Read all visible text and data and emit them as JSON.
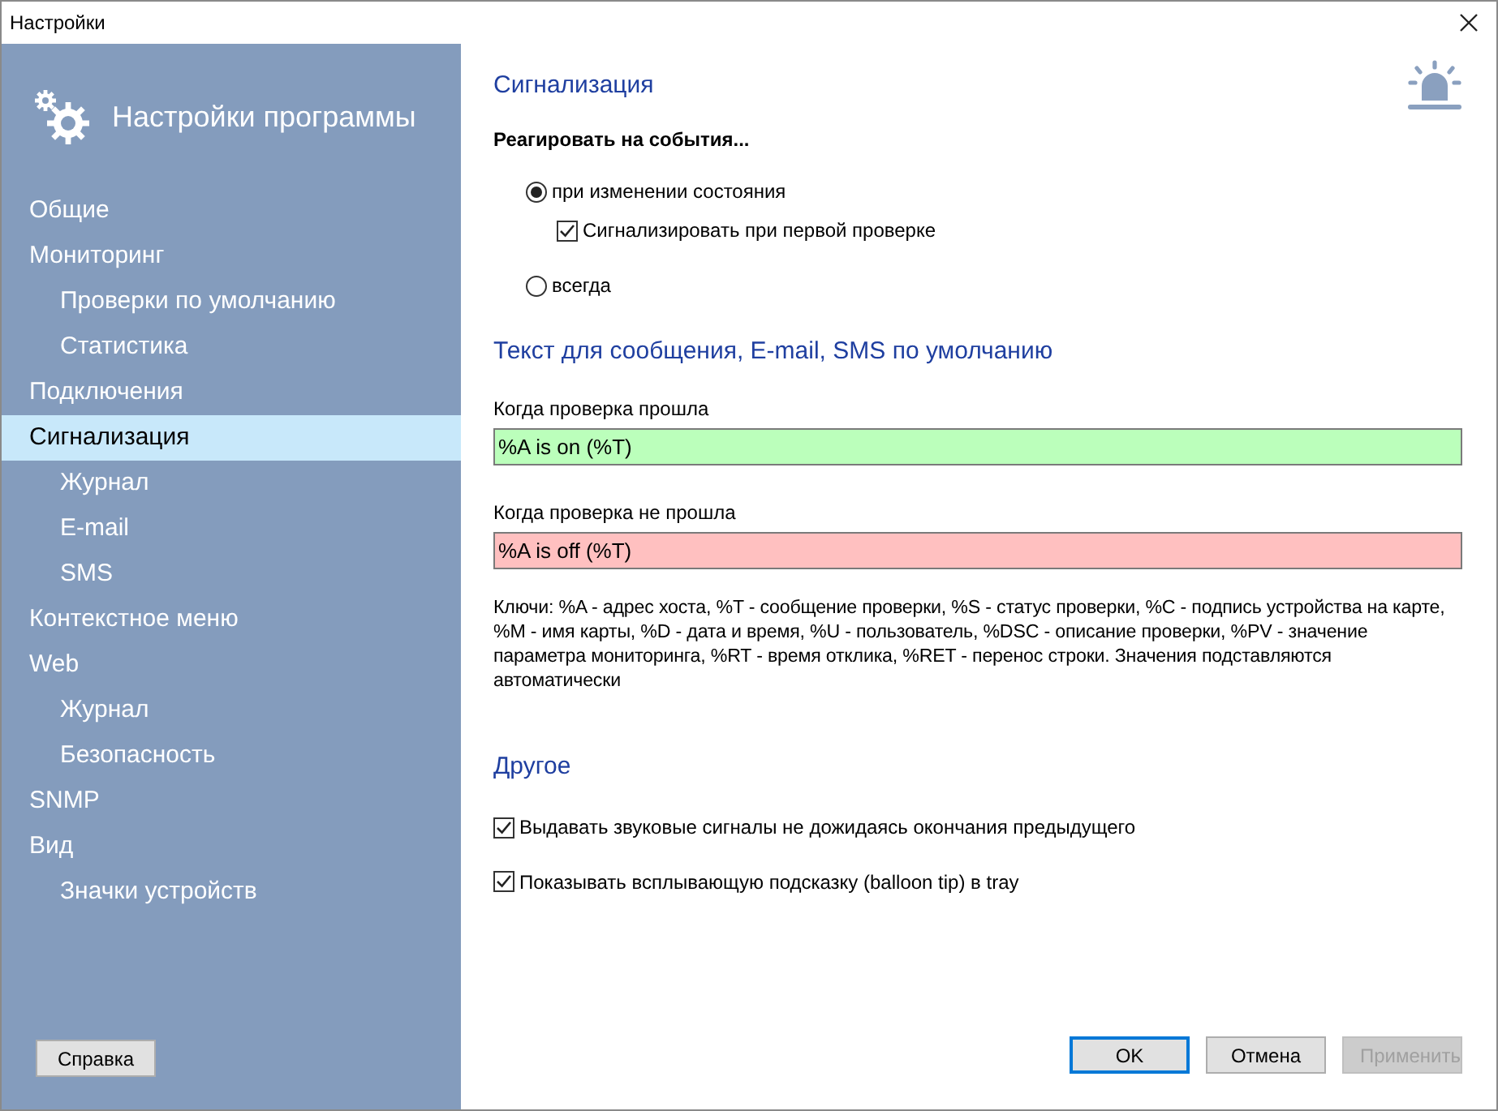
{
  "window": {
    "title": "Настройки"
  },
  "sidebar": {
    "title": "Настройки программы",
    "items": [
      {
        "label": "Общие",
        "selected": false
      },
      {
        "label": "Мониторинг",
        "selected": false,
        "children": [
          {
            "label": "Проверки по умолчанию",
            "selected": false
          },
          {
            "label": "Статистика",
            "selected": false
          }
        ]
      },
      {
        "label": "Подключения",
        "selected": false
      },
      {
        "label": "Сигнализация",
        "selected": true,
        "children": [
          {
            "label": "Журнал",
            "selected": false
          },
          {
            "label": "E-mail",
            "selected": false
          },
          {
            "label": "SMS",
            "selected": false
          }
        ]
      },
      {
        "label": "Контекстное меню",
        "selected": false
      },
      {
        "label": "Web",
        "selected": false,
        "children": [
          {
            "label": "Журнал",
            "selected": false
          },
          {
            "label": "Безопасность",
            "selected": false
          }
        ]
      },
      {
        "label": "SNMP",
        "selected": false
      },
      {
        "label": "Вид",
        "selected": false,
        "children": [
          {
            "label": "Значки устройств",
            "selected": false
          }
        ]
      }
    ],
    "help_button": "Справка"
  },
  "alarm": {
    "title": "Сигнализация",
    "react_label": "Реагировать на события...",
    "options": [
      {
        "kind": "radio",
        "label": "при изменении состояния",
        "selected": true,
        "children": [
          {
            "kind": "checkbox",
            "label": "Сигнализировать при первой проверке",
            "checked": true
          }
        ]
      },
      {
        "kind": "radio",
        "label": "всегда",
        "selected": false
      }
    ]
  },
  "message": {
    "title": "Текст для сообщения, E-mail, SMS по умолчанию",
    "fields": [
      {
        "label": "Когда проверка прошла",
        "value": "%A is on (%T)",
        "kind": "pass"
      },
      {
        "label": "Когда проверка не прошла",
        "value": "%A is off (%T)",
        "kind": "fail"
      }
    ],
    "keys_note": "Ключи: %A - адрес хоста, %T - сообщение проверки, %S - статус проверки, %C - подпись устройства на карте, %M - имя карты, %D - дата и время, %U - пользователь, %DSC - описание проверки, %PV - значение параметра мониторинга, %RT - время отклика, %RET - перенос строки. Значения подставляются автоматически"
  },
  "other": {
    "title": "Другое",
    "checkboxes": [
      {
        "label": "Выдавать звуковые сигналы не дожидаясь окончания предыдущего",
        "checked": true
      },
      {
        "label": "Показывать всплывающую подсказку (balloon tip) в tray",
        "checked": true
      }
    ]
  },
  "buttons": [
    {
      "label": "OK",
      "kind": "default",
      "disabled": false
    },
    {
      "label": "Отмена",
      "kind": "normal",
      "disabled": false
    },
    {
      "label": "Применить",
      "kind": "normal",
      "disabled": true
    }
  ]
}
